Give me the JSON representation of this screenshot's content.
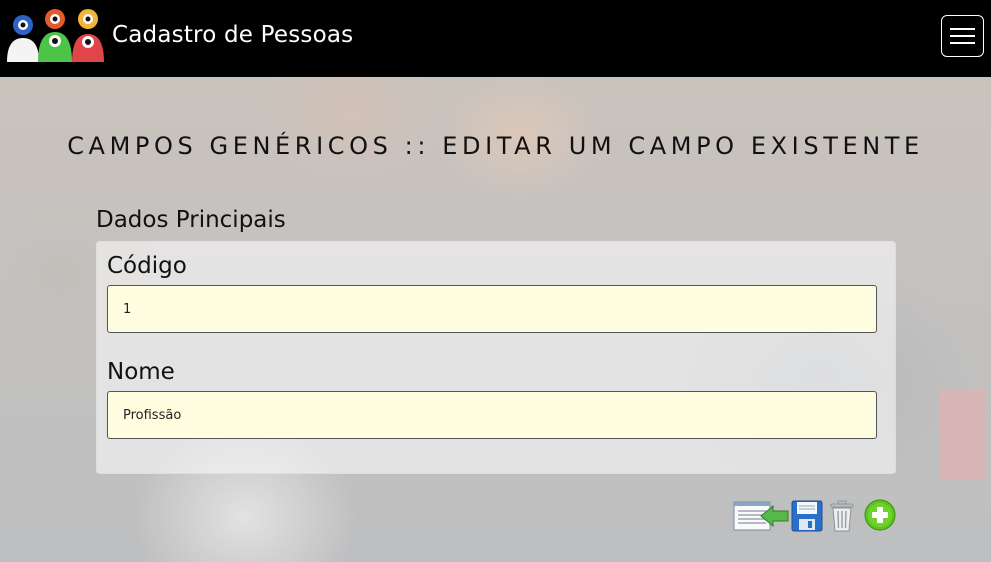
{
  "navbar": {
    "brand_title": "Cadastro de Pessoas",
    "logo_icon": "people-group-icon",
    "menu_icon": "hamburger-menu-icon"
  },
  "page": {
    "title": "CAMPOS GENÉRICOS :: EDITAR UM CAMPO EXISTENTE"
  },
  "section": {
    "label": "Dados Principais"
  },
  "form": {
    "codigo": {
      "label": "Código",
      "value": "1"
    },
    "nome": {
      "label": "Nome",
      "value": "Profissão"
    }
  },
  "actions": [
    {
      "name": "back-to-list-button",
      "icon": "list-back-arrow-icon"
    },
    {
      "name": "save-button",
      "icon": "floppy-disk-icon"
    },
    {
      "name": "delete-button",
      "icon": "trash-can-icon"
    },
    {
      "name": "add-button",
      "icon": "plus-circle-icon"
    }
  ],
  "colors": {
    "navbar_bg": "#000000",
    "input_bg": "#fffde0",
    "add_green": "#5cc41e",
    "save_blue": "#2a6fc9"
  }
}
